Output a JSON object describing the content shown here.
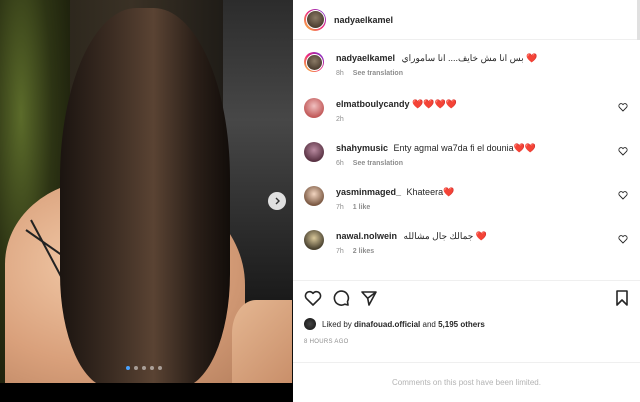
{
  "post": {
    "username": "nadyaelkamel",
    "caption": {
      "username": "nadyaelkamel",
      "text": "بس انا مش خايف.... انا ساموراي",
      "time": "8h",
      "see_translation": "See translation"
    },
    "carousel": {
      "total_slides": 5,
      "active_index": 0
    }
  },
  "comments": [
    {
      "username": "elmatboulycandy",
      "text": "",
      "hearts": "❤️❤️❤️❤️",
      "time": "2h",
      "extra": ""
    },
    {
      "username": "shahymusic",
      "text": "Enty agmal wa7da fi el dounia",
      "hearts": "❤️❤️",
      "time": "6h",
      "extra": "See translation"
    },
    {
      "username": "yasminmaged_",
      "text": "Khateera",
      "hearts": "❤️",
      "time": "7h",
      "extra": "1 like"
    },
    {
      "username": "nawal.nolwein",
      "text": "جمالك جال مشالله",
      "hearts": "❤️",
      "time": "7h",
      "extra": "2 likes"
    }
  ],
  "likes": {
    "prefix": "Liked by",
    "user": "dinafouad.official",
    "and": "and",
    "count": "5,195 others"
  },
  "time_ago": "8 HOURS AGO",
  "limited_notice": "Comments on this post have been limited.",
  "colors": {
    "heart": "#ed4956",
    "meta": "#8e8e8e",
    "text": "#262626"
  },
  "icons": [
    "next-arrow-icon",
    "heart-outline-icon",
    "comment-icon",
    "share-icon",
    "bookmark-icon"
  ]
}
